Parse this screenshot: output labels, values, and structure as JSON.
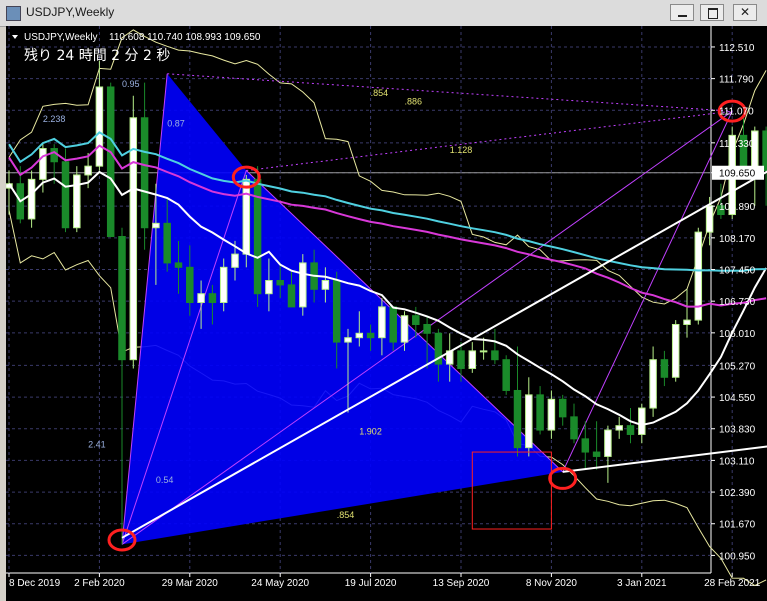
{
  "window": {
    "title": "USDJPY,Weekly",
    "close_glyph": "✕"
  },
  "chart_header": {
    "symbol_tf": "USDJPY,Weekly",
    "ohlc": "110.608 110.740 108.993 109.650",
    "countdown": "残り 24 時間 2 分 2 秒"
  },
  "colors": {
    "bg": "#000000",
    "grid": "#3a3a6a",
    "bull": "#b8f08a",
    "bull_body": "#ffffff",
    "bear": "#1a8a2a",
    "pattern_fill": "#0000ff",
    "ma_white": "#ffffff",
    "ma_cyan": "#4fd0e0",
    "ma_magenta": "#d838d8",
    "bands": "#e8e8a0",
    "trendline": "#ffffff",
    "marker": "#ff2020",
    "box": "#ff2020"
  },
  "chart_data": {
    "type": "candlestick",
    "symbol": "USDJPY",
    "timeframe": "Weekly",
    "ylim": [
      100.55,
      112.85
    ],
    "y_ticks": [
      "112.510",
      "111.790",
      "111.070",
      "110.330",
      "109.650",
      "108.890",
      "108.170",
      "107.450",
      "106.730",
      "106.010",
      "105.270",
      "104.550",
      "103.830",
      "103.110",
      "102.390",
      "101.670",
      "100.950"
    ],
    "current_price": "109.650",
    "x_ticks": [
      "8 Dec 2019",
      "2 Feb 2020",
      "29 Mar 2020",
      "24 May 2020",
      "19 Jul 2020",
      "13 Sep 2020",
      "8 Nov 2020",
      "3 Jan 2021",
      "28 Feb 2021"
    ],
    "tick_weeks": [
      0,
      8,
      16,
      24,
      32,
      40,
      48,
      56,
      64
    ],
    "candles": [
      [
        109.3,
        109.7,
        108.7,
        109.4
      ],
      [
        109.4,
        109.8,
        108.5,
        108.6
      ],
      [
        108.6,
        109.7,
        108.4,
        109.5
      ],
      [
        109.5,
        110.3,
        109.2,
        110.2
      ],
      [
        110.2,
        110.3,
        109.4,
        109.9
      ],
      [
        109.9,
        110.2,
        108.3,
        108.4
      ],
      [
        108.4,
        109.8,
        108.3,
        109.6
      ],
      [
        109.6,
        110.1,
        109.3,
        109.8
      ],
      [
        109.8,
        112.2,
        109.7,
        111.6
      ],
      [
        111.6,
        111.7,
        108.3,
        108.2
      ],
      [
        108.2,
        108.4,
        101.2,
        105.4
      ],
      [
        105.4,
        111.4,
        105.2,
        110.9
      ],
      [
        110.9,
        111.7,
        107.9,
        108.4
      ],
      [
        108.4,
        109.4,
        107.1,
        108.5
      ],
      [
        108.5,
        109.1,
        107.4,
        107.6
      ],
      [
        107.6,
        108.1,
        106.9,
        107.5
      ],
      [
        107.5,
        108.0,
        106.4,
        106.7
      ],
      [
        106.7,
        107.2,
        106.1,
        106.9
      ],
      [
        106.9,
        107.1,
        106.2,
        106.7
      ],
      [
        106.7,
        107.7,
        106.5,
        107.5
      ],
      [
        107.5,
        108.1,
        107.2,
        107.8
      ],
      [
        107.8,
        109.6,
        107.5,
        109.5
      ],
      [
        109.5,
        109.8,
        106.6,
        106.9
      ],
      [
        106.9,
        107.7,
        106.5,
        107.2
      ],
      [
        107.2,
        107.6,
        106.8,
        107.1
      ],
      [
        107.1,
        107.4,
        106.6,
        106.6
      ],
      [
        106.6,
        107.8,
        106.4,
        107.6
      ],
      [
        107.6,
        107.9,
        106.7,
        107.0
      ],
      [
        107.0,
        107.5,
        106.7,
        107.2
      ],
      [
        107.2,
        107.4,
        105.2,
        105.8
      ],
      [
        105.8,
        106.1,
        104.2,
        105.9
      ],
      [
        105.9,
        106.5,
        105.7,
        106.0
      ],
      [
        106.0,
        106.2,
        105.6,
        105.9
      ],
      [
        105.9,
        106.8,
        105.5,
        106.6
      ],
      [
        106.6,
        106.6,
        105.6,
        105.8
      ],
      [
        105.8,
        106.5,
        105.6,
        106.4
      ],
      [
        106.4,
        106.6,
        105.9,
        106.2
      ],
      [
        106.2,
        106.4,
        105.2,
        106.0
      ],
      [
        106.0,
        106.1,
        104.9,
        105.3
      ],
      [
        105.3,
        106.0,
        104.9,
        105.6
      ],
      [
        105.6,
        105.8,
        104.9,
        105.2
      ],
      [
        105.2,
        105.8,
        105.1,
        105.6
      ],
      [
        105.6,
        105.9,
        105.4,
        105.6
      ],
      [
        105.6,
        106.1,
        105.3,
        105.4
      ],
      [
        105.4,
        105.5,
        104.6,
        104.7
      ],
      [
        104.7,
        105.7,
        103.2,
        103.4
      ],
      [
        103.4,
        105.0,
        103.2,
        104.6
      ],
      [
        104.6,
        104.8,
        103.7,
        103.8
      ],
      [
        103.8,
        104.7,
        103.6,
        104.5
      ],
      [
        104.5,
        104.6,
        103.9,
        104.1
      ],
      [
        104.1,
        104.4,
        103.5,
        103.6
      ],
      [
        103.6,
        104.0,
        102.9,
        103.3
      ],
      [
        103.3,
        104.0,
        102.9,
        103.2
      ],
      [
        103.2,
        103.9,
        102.6,
        103.8
      ],
      [
        103.8,
        104.1,
        103.6,
        103.9
      ],
      [
        103.9,
        104.3,
        103.5,
        103.7
      ],
      [
        103.7,
        104.4,
        103.5,
        104.3
      ],
      [
        104.3,
        105.7,
        104.1,
        105.4
      ],
      [
        105.4,
        105.6,
        104.8,
        105.0
      ],
      [
        105.0,
        106.3,
        104.9,
        106.2
      ],
      [
        106.2,
        107.0,
        105.9,
        106.3
      ],
      [
        106.3,
        108.4,
        106.2,
        108.3
      ],
      [
        108.3,
        109.1,
        108.0,
        108.9
      ],
      [
        108.9,
        109.4,
        108.6,
        108.7
      ],
      [
        108.7,
        110.7,
        108.6,
        110.5
      ],
      [
        110.5,
        110.9,
        109.5,
        109.7
      ],
      [
        109.7,
        110.7,
        108.9,
        110.6
      ],
      [
        110.6,
        110.7,
        108.9,
        109.7
      ]
    ],
    "harmonic_pattern": {
      "X": [
        14,
        111.9
      ],
      "A": [
        10,
        101.2
      ],
      "B": [
        21,
        109.7
      ],
      "C": [
        49,
        102.85
      ],
      "D": [
        64,
        111.05
      ]
    },
    "harmonic_ratios": [
      "2.238",
      "0.95",
      "0.87",
      "2.41",
      "0.54",
      "1.902",
      "1.128",
      ".854",
      ".886",
      ".854"
    ],
    "trendlines": [
      {
        "from": [
          10,
          101.35
        ],
        "to": [
          82,
          111.85
        ]
      },
      {
        "from": [
          49,
          102.85
        ],
        "to": [
          82,
          103.9
        ]
      }
    ],
    "circle_markers": [
      [
        10,
        101.3
      ],
      [
        21,
        109.55
      ],
      [
        49,
        102.7
      ],
      [
        64,
        111.05
      ]
    ],
    "highlight_box": {
      "w0": 41,
      "w1": 48,
      "p0": 101.55,
      "p1": 103.3
    }
  }
}
